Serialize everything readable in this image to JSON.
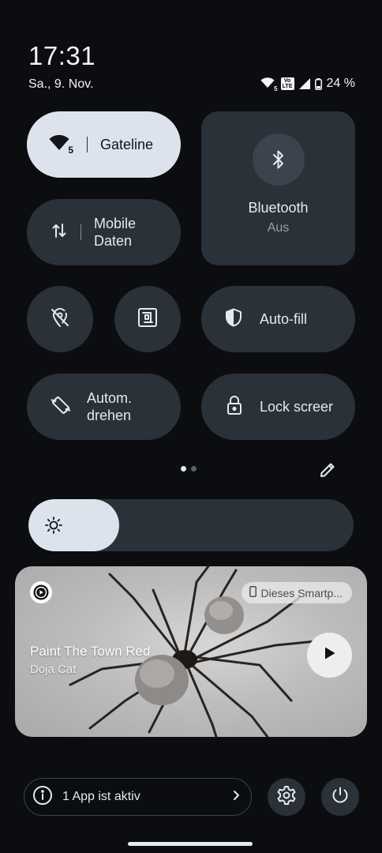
{
  "status": {
    "time": "17:31",
    "date": "Sa., 9. Nov.",
    "wifi_badge": "5",
    "volte_top": "Vo",
    "volte_bottom": "LTE",
    "battery": "24 %"
  },
  "tiles": {
    "wifi": {
      "label": "Gateline",
      "badge": "5",
      "icon": "wifi-icon",
      "active": true
    },
    "mobile_data": {
      "label_line1": "Mobile",
      "label_line2": "Daten",
      "icon": "data-arrows-icon"
    },
    "bluetooth": {
      "label": "Bluetooth",
      "state": "Aus",
      "icon": "bluetooth-icon"
    },
    "location": {
      "icon": "location-off-icon"
    },
    "nfc": {
      "icon": "nfc-icon"
    },
    "autofill": {
      "label": "Auto-fill",
      "icon": "shield-icon"
    },
    "auto_rotate": {
      "label_line1": "Autom.",
      "label_line2": "drehen",
      "icon": "rotate-icon"
    },
    "lock_screen": {
      "label": "Lock screer",
      "icon": "lock-icon"
    }
  },
  "pager": {
    "pages": 2,
    "current": 1
  },
  "brightness": {
    "level": 0.28,
    "icon": "brightness-icon"
  },
  "media": {
    "title": "Paint The Town Red",
    "artist": "Doja Cat",
    "device": "Dieses Smartp...",
    "app_icon": "play-circle-icon",
    "action_icon": "play-icon"
  },
  "footer": {
    "active_apps_label": "1 App ist aktiv",
    "info_icon": "info-icon",
    "chevron_icon": "chevron-right-icon",
    "settings_icon": "gear-icon",
    "power_icon": "power-icon"
  },
  "colors": {
    "background": "#0b0d10",
    "tile": "#2b3138",
    "tile_active": "#dde3ec"
  }
}
